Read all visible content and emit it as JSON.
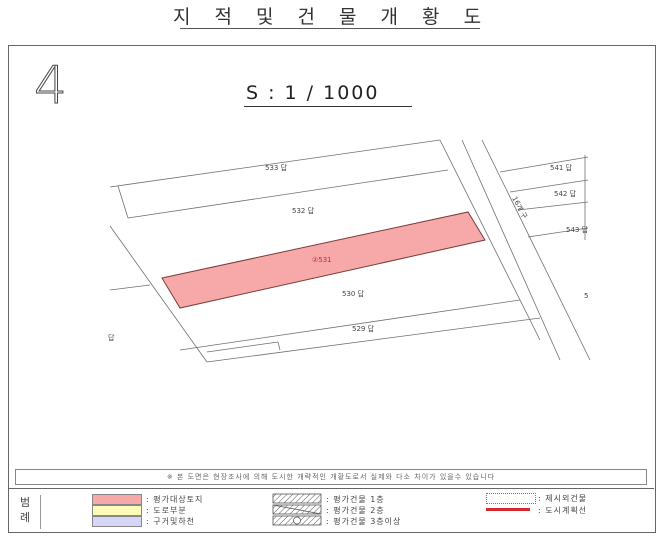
{
  "document": {
    "title": "지 적 및 건 물 개 황 도",
    "page_number": "4",
    "scale": "S : 1 / 1000"
  },
  "map": {
    "parcels": {
      "p533": "533 답",
      "p532": "532 답",
      "subject": "②531",
      "p530": "530 답",
      "p529": "529 답",
      "p541": "541 답",
      "p542": "542 답",
      "p543": "543 답",
      "edge_s": "5",
      "edge_left": "답"
    },
    "road_label": "16개 구",
    "small_label": "ᅟᅟ",
    "colors": {
      "subject_fill": "#f7a9aa",
      "subject_stroke": "#7a3a3a",
      "line": "#6f6f6f",
      "urban_line": "#d6282e"
    }
  },
  "notice": "※ 본 도면은 현장조사에 의해 도시한 개략적인 개황도로서 실제와 다소 차이가 있을수 있습니다",
  "legend": {
    "title_line1": "범",
    "title_line2": "례",
    "items": [
      {
        "label": ": 평가대상토지",
        "color": "#f7a9aa"
      },
      {
        "label": ": 도로부분",
        "color": "#fdfbb8"
      },
      {
        "label": ": 구거및하천",
        "color": "#d6d6f7"
      },
      {
        "label": ": 평가건물 1층"
      },
      {
        "label": ": 평가건물 2층"
      },
      {
        "label": ": 평가건물 3층이상"
      },
      {
        "label": ": 제시외건물"
      },
      {
        "label": ": 도시계획선",
        "color": "#d6282e"
      }
    ]
  }
}
